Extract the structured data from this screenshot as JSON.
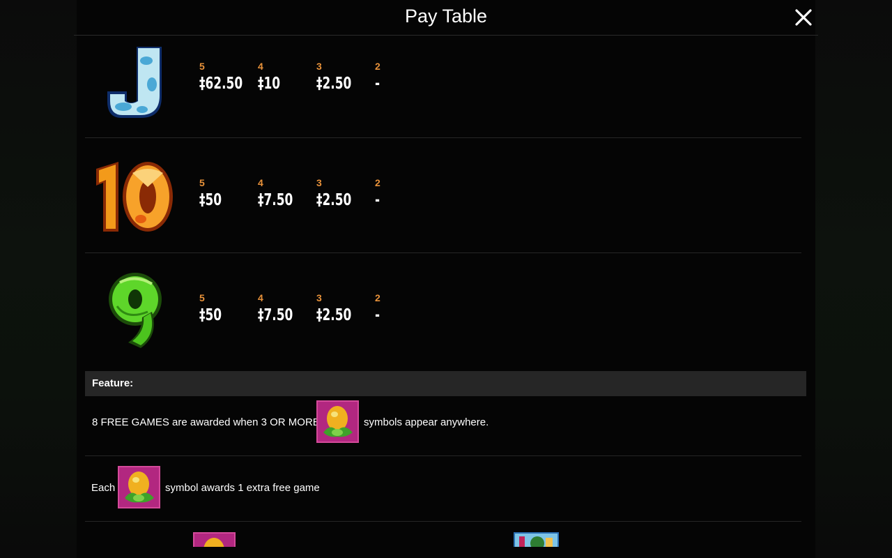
{
  "header": {
    "title": "Pay Table"
  },
  "paytable": {
    "count_labels": [
      "5",
      "4",
      "3",
      "2"
    ],
    "rows": [
      {
        "symbol": "J",
        "payouts": [
          "‡62.50",
          "‡10",
          "‡2.50",
          "-"
        ]
      },
      {
        "symbol": "10",
        "payouts": [
          "‡50",
          "‡7.50",
          "‡2.50",
          "-"
        ]
      },
      {
        "symbol": "9",
        "payouts": [
          "‡50",
          "‡7.50",
          "‡2.50",
          "-"
        ]
      }
    ]
  },
  "feature": {
    "label": "Feature:",
    "line1_before": "8 FREE GAMES are awarded when 3 OR MORE",
    "line1_after": "symbols appear anywhere.",
    "line2_before": "Each",
    "line2_after": "symbol awards 1 extra free game"
  },
  "icons": {
    "close": "close-icon",
    "scatter": "dinosaur-egg-icon"
  },
  "colors": {
    "count_label": "#e8923a",
    "scatter_frame": "#b22780",
    "feature_bar": "#262626"
  }
}
